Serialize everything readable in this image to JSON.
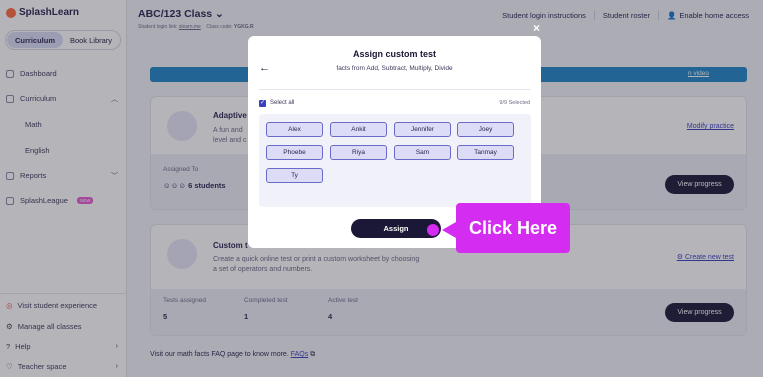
{
  "brand": {
    "name": "SplashLearn"
  },
  "sidebar": {
    "toggle": {
      "curriculum": "Curriculum",
      "book_library": "Book Library"
    },
    "items": [
      {
        "label": "Dashboard"
      },
      {
        "label": "Curriculum"
      },
      {
        "label": "Math"
      },
      {
        "label": "English"
      },
      {
        "label": "Reports"
      },
      {
        "label": "SplashLeague",
        "badge": "NEW"
      }
    ],
    "bottom": [
      {
        "label": "Visit student experience"
      },
      {
        "label": "Manage all classes"
      },
      {
        "label": "Help"
      },
      {
        "label": "Teacher space"
      }
    ]
  },
  "header": {
    "class_title": "ABC/123 Class",
    "login_link_label": "Student login link:",
    "login_link": "slearn.me",
    "class_code_label": "Class code:",
    "class_code": "YGKG.R",
    "links": [
      "Student login instructions",
      "Student roster",
      "Enable home access"
    ]
  },
  "banner": {
    "link": "n video"
  },
  "adaptive_card": {
    "title": "Adaptive",
    "desc_line1": "A fun and",
    "desc_line2": "level and c",
    "link": "Modify practice",
    "assigned_label": "Assigned To",
    "students": "6 students",
    "button": "View progress"
  },
  "custom_card": {
    "title": "Custom t",
    "desc_line1": "Create a quick online test or print a custom worksheet by choosing",
    "desc_line2": "a set of operators and numbers.",
    "link": "Create new test",
    "stats": [
      {
        "label": "Tests assigned",
        "value": "5"
      },
      {
        "label": "Completed test",
        "value": "1"
      },
      {
        "label": "Active test",
        "value": "4"
      }
    ],
    "button": "View progress"
  },
  "faq": {
    "text": "Visit our math facts FAQ page to know more.",
    "link": "FAQs"
  },
  "modal": {
    "title": "Assign custom test",
    "subtitle": "facts from Add, Subtract, Multiply, Divide",
    "select_all": "Select all",
    "selected_count": "9/9 Selected",
    "students": [
      "Alex",
      "Ankit",
      "Jennifer",
      "Joey",
      "Phoebe",
      "Riya",
      "Sam",
      "Tanmay",
      "Ty"
    ],
    "assign_button": "Assign",
    "close": "×"
  },
  "callout": {
    "text": "Click Here"
  },
  "colors": {
    "accent": "#3a3fbf",
    "dark": "#1b1736",
    "callout": "#d42cf0",
    "banner": "#1f86c8"
  }
}
